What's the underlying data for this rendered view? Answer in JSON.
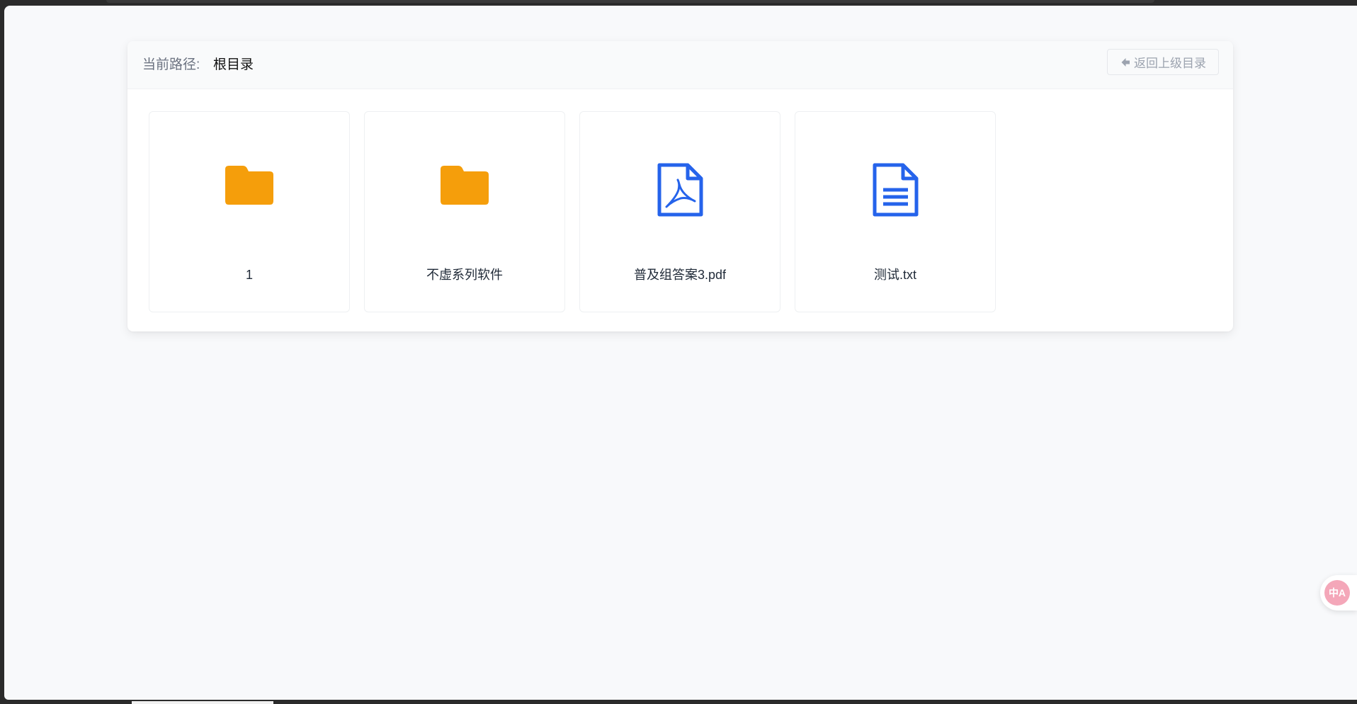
{
  "header": {
    "path_label": "当前路径:",
    "path_value": "根目录",
    "back_label": "返回上级目录"
  },
  "items": [
    {
      "name": "1",
      "type": "folder",
      "icon": "folder-icon"
    },
    {
      "name": "不虚系列软件",
      "type": "folder",
      "icon": "folder-icon"
    },
    {
      "name": "普及组答案3.pdf",
      "type": "pdf",
      "icon": "pdf-file-icon"
    },
    {
      "name": "测试.txt",
      "type": "txt",
      "icon": "text-file-icon"
    }
  ],
  "translate_widget": {
    "label": "中A",
    "icon": "translate-icon"
  },
  "colors": {
    "folder": "#f59e0b",
    "file_icon": "#2563eb",
    "page_bg": "#f8f9fb",
    "translate": "#f4a7b9"
  }
}
